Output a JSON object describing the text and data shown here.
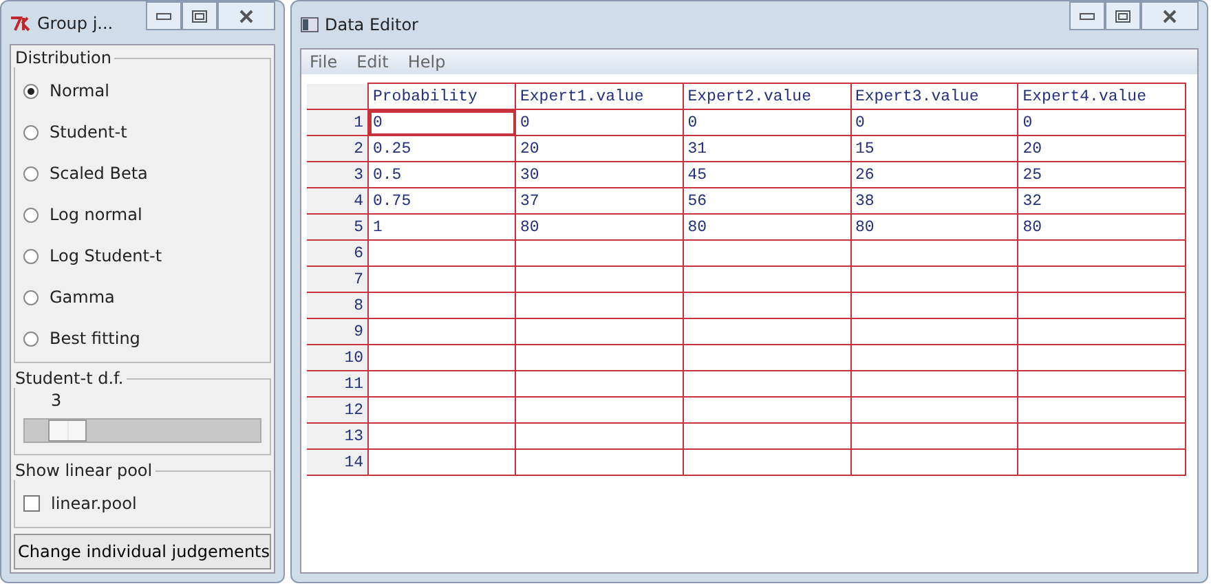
{
  "group_window": {
    "title": "Group j...",
    "distribution": {
      "label": "Distribution",
      "options": [
        {
          "label": "Normal",
          "selected": true
        },
        {
          "label": "Student-t",
          "selected": false
        },
        {
          "label": "Scaled Beta",
          "selected": false
        },
        {
          "label": "Log normal",
          "selected": false
        },
        {
          "label": "Log Student-t",
          "selected": false
        },
        {
          "label": "Gamma",
          "selected": false
        },
        {
          "label": "Best fitting",
          "selected": false
        }
      ]
    },
    "df": {
      "label": "Student-t d.f.",
      "value": "3",
      "level": 0.1
    },
    "pool": {
      "label": "Show linear pool",
      "checkbox": {
        "label": "linear.pool",
        "checked": false
      }
    },
    "button": "Change individual judgements"
  },
  "editor_window": {
    "title": "Data Editor",
    "menu": [
      "File",
      "Edit",
      "Help"
    ],
    "table": {
      "columns": [
        "Probability",
        "Expert1.value",
        "Expert2.value",
        "Expert3.value",
        "Expert4.value"
      ],
      "rows": [
        {
          "number": "1",
          "cells": [
            "0",
            "0",
            "0",
            "0",
            "0"
          ]
        },
        {
          "number": "2",
          "cells": [
            "0.25",
            "20",
            "31",
            "15",
            "20"
          ]
        },
        {
          "number": "3",
          "cells": [
            "0.5",
            "30",
            "45",
            "26",
            "25"
          ]
        },
        {
          "number": "4",
          "cells": [
            "0.75",
            "37",
            "56",
            "38",
            "32"
          ]
        },
        {
          "number": "5",
          "cells": [
            "1",
            "80",
            "80",
            "80",
            "80"
          ]
        },
        {
          "number": "6",
          "cells": [
            "",
            "",
            "",
            "",
            ""
          ]
        },
        {
          "number": "7",
          "cells": [
            "",
            "",
            "",
            "",
            ""
          ]
        },
        {
          "number": "8",
          "cells": [
            "",
            "",
            "",
            "",
            ""
          ]
        },
        {
          "number": "9",
          "cells": [
            "",
            "",
            "",
            "",
            ""
          ]
        },
        {
          "number": "10",
          "cells": [
            "",
            "",
            "",
            "",
            ""
          ]
        },
        {
          "number": "11",
          "cells": [
            "",
            "",
            "",
            "",
            ""
          ]
        },
        {
          "number": "12",
          "cells": [
            "",
            "",
            "",
            "",
            ""
          ]
        },
        {
          "number": "13",
          "cells": [
            "",
            "",
            "",
            "",
            ""
          ]
        },
        {
          "number": "14",
          "cells": [
            "",
            "",
            "",
            "",
            ""
          ]
        }
      ]
    }
  }
}
